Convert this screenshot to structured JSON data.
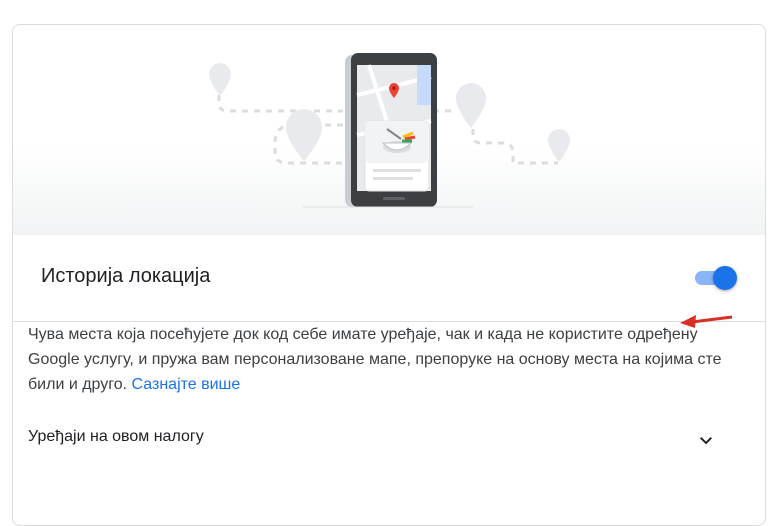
{
  "section": {
    "title": "Историја локација",
    "toggle_state": "on"
  },
  "description": {
    "text": "Чува места која посећујете док код себе имате уређаје, чак и када не користите одређену Google услугу, и пружа вам персонализоване мапе, препоруке на основу места на којима сте били и друго.",
    "link": "Сазнајте више"
  },
  "devices": {
    "label": "Уређаји на овом налогу"
  },
  "colors": {
    "accent": "#1a73e8",
    "track": "#8ab4f8",
    "annotation_arrow": "#d93025",
    "map_pin": "#ea4335"
  },
  "icons": {
    "expand": "chevron-down-icon",
    "illustration": "phone-map-illustration"
  }
}
